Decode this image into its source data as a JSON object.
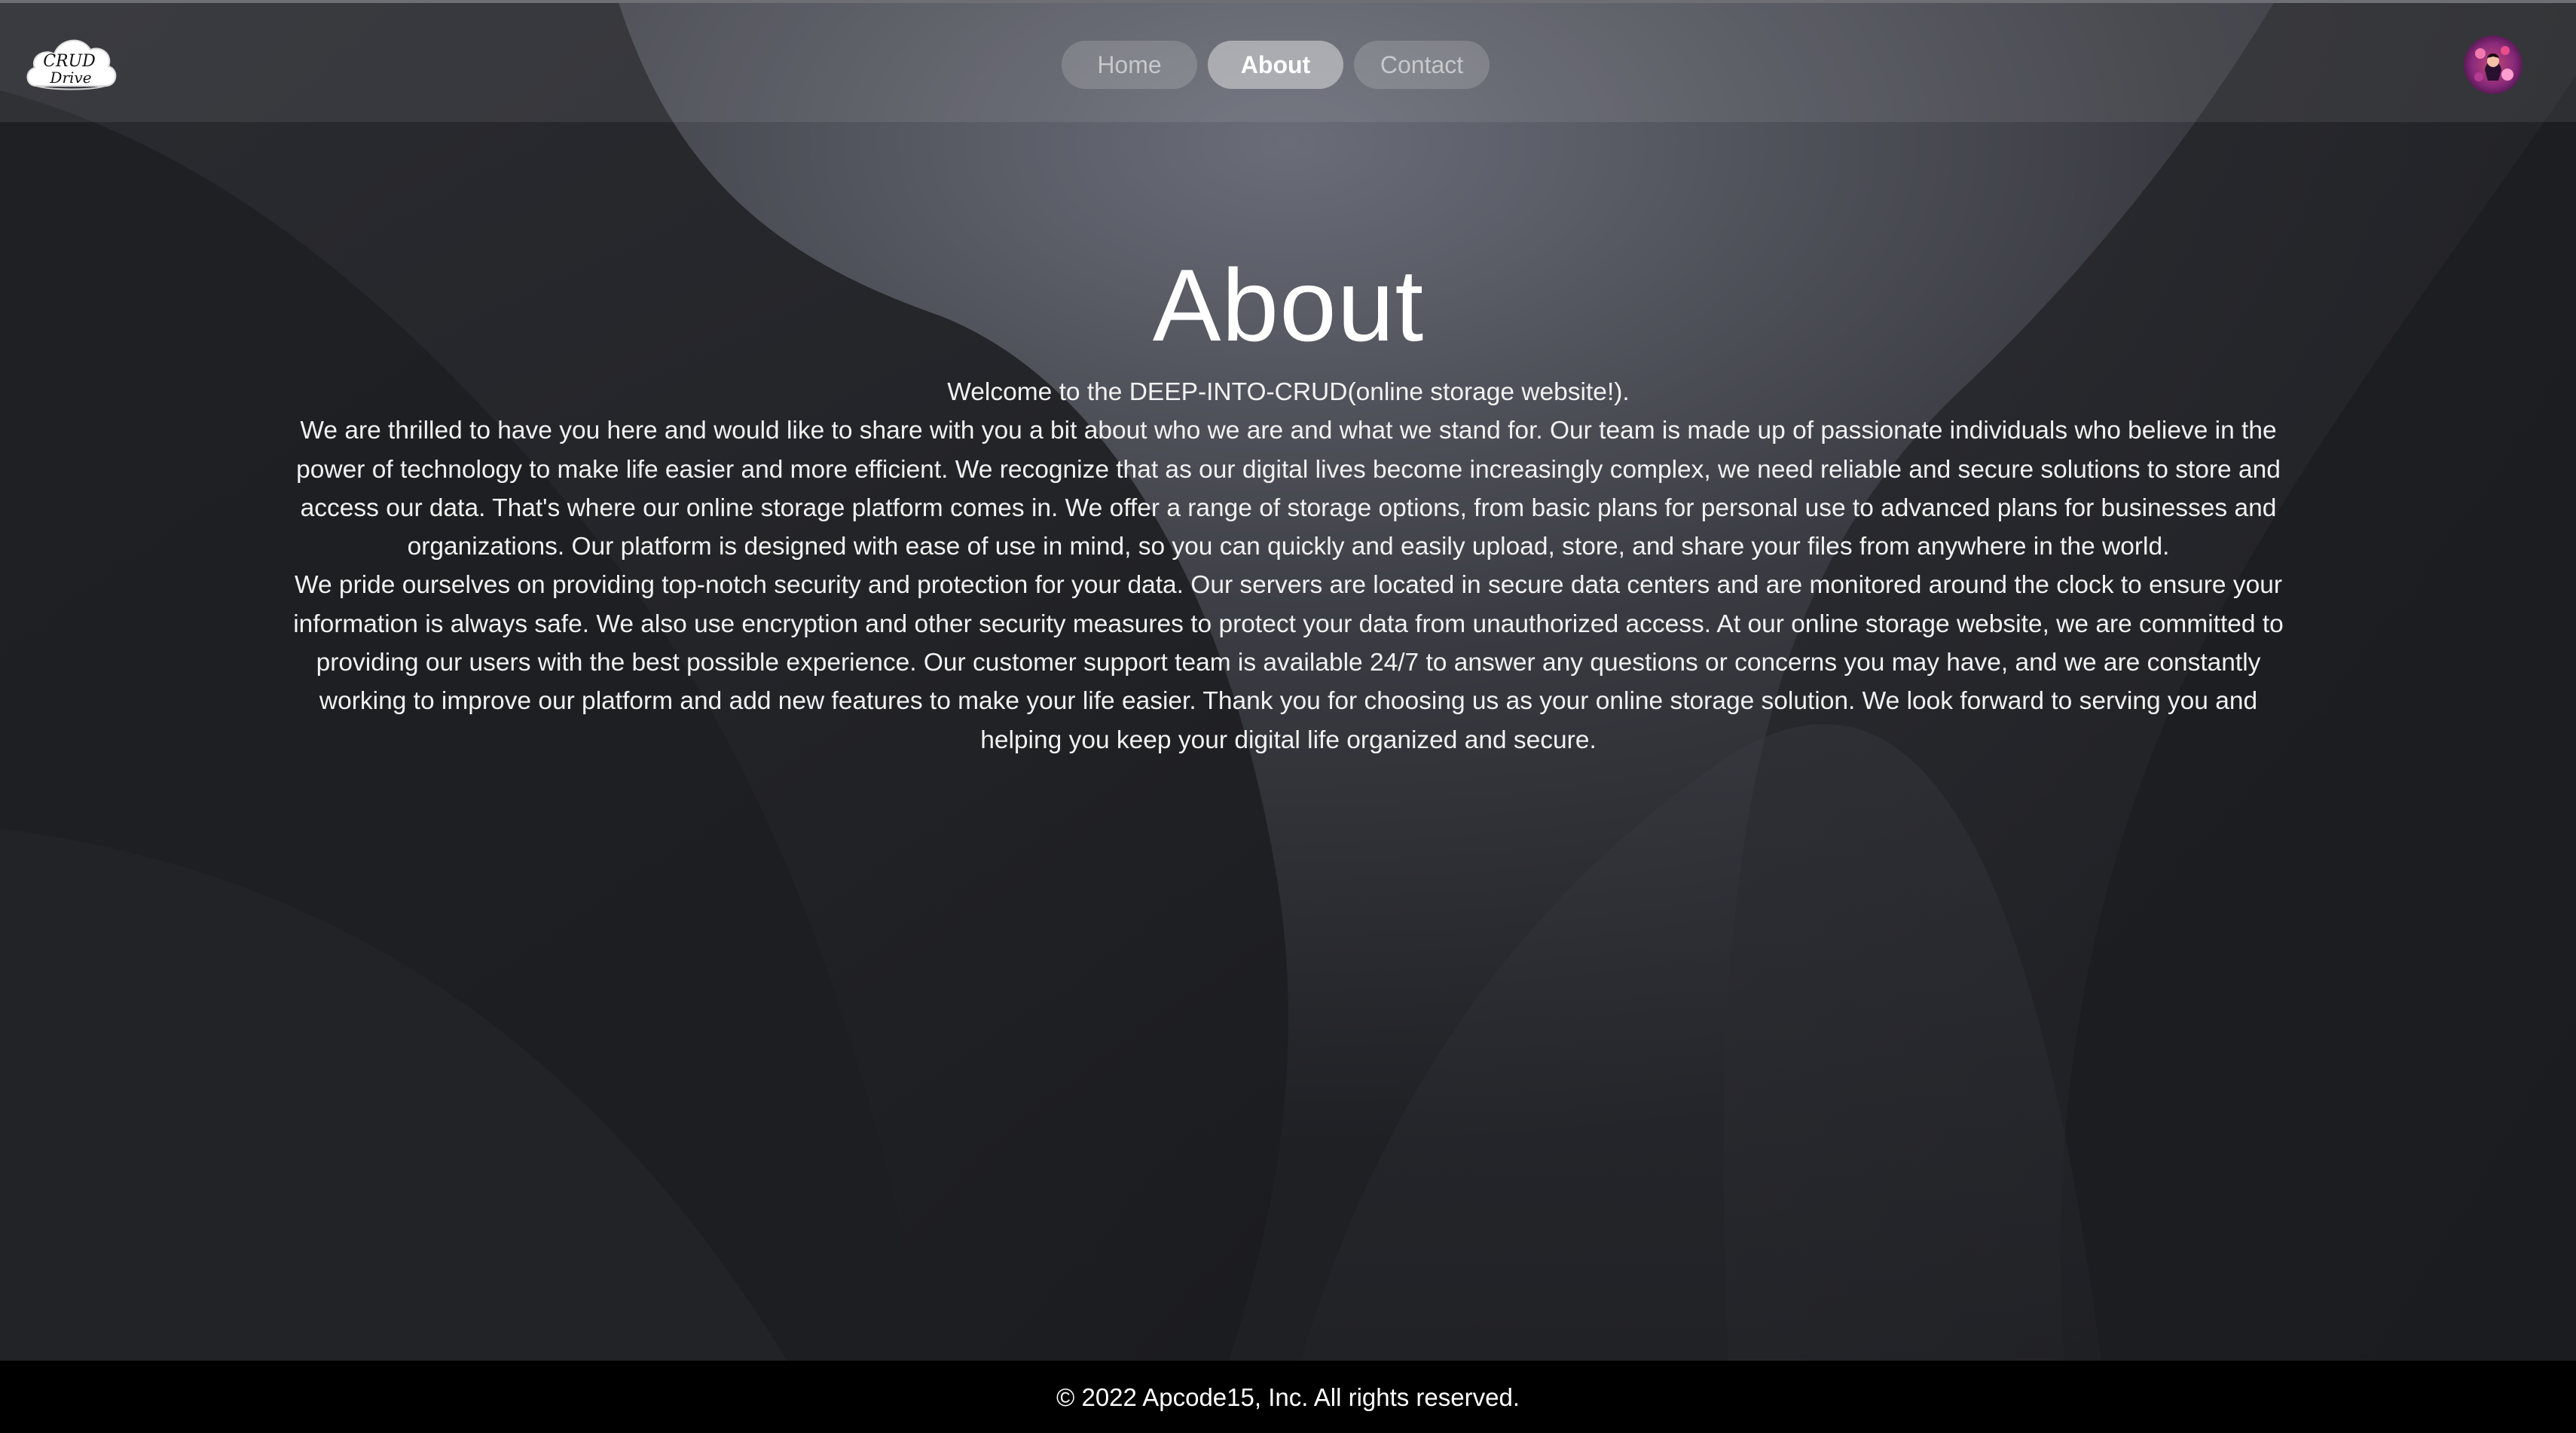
{
  "navbar": {
    "logo_text_line1": "CRUD",
    "logo_text_line2": "Drive",
    "links": [
      {
        "label": "Home",
        "active": false
      },
      {
        "label": "About",
        "active": true
      },
      {
        "label": "Contact",
        "active": false
      }
    ],
    "avatar_icon": "user-avatar"
  },
  "main": {
    "title": "About",
    "intro": "Welcome to the DEEP-INTO-CRUD(online storage website!).",
    "paragraph1": "We are thrilled to have you here and would like to share with you a bit about who we are and what we stand for. Our team is made up of passionate individuals who believe in the power of technology to make life easier and more efficient. We recognize that as our digital lives become increasingly complex, we need reliable and secure solutions to store and access our data. That's where our online storage platform comes in. We offer a range of storage options, from basic plans for personal use to advanced plans for businesses and organizations. Our platform is designed with ease of use in mind, so you can quickly and easily upload, store, and share your files from anywhere in the world.",
    "paragraph2": "We pride ourselves on providing top-notch security and protection for your data. Our servers are located in secure data centers and are monitored around the clock to ensure your information is always safe. We also use encryption and other security measures to protect your data from unauthorized access. At our online storage website, we are committed to providing our users with the best possible experience. Our customer support team is available 24/7 to answer any questions or concerns you may have, and we are constantly working to improve our platform and add new features to make your life easier. Thank you for choosing us as your online storage solution. We look forward to serving you and helping you keep your digital life organized and secure."
  },
  "footer": {
    "text": "© 2022 Apcode15, Inc. All rights reserved."
  },
  "colors": {
    "background": "#1e1f23",
    "footer": "#000000",
    "active_pill": "#8a8b8f",
    "text": "#ffffff"
  }
}
